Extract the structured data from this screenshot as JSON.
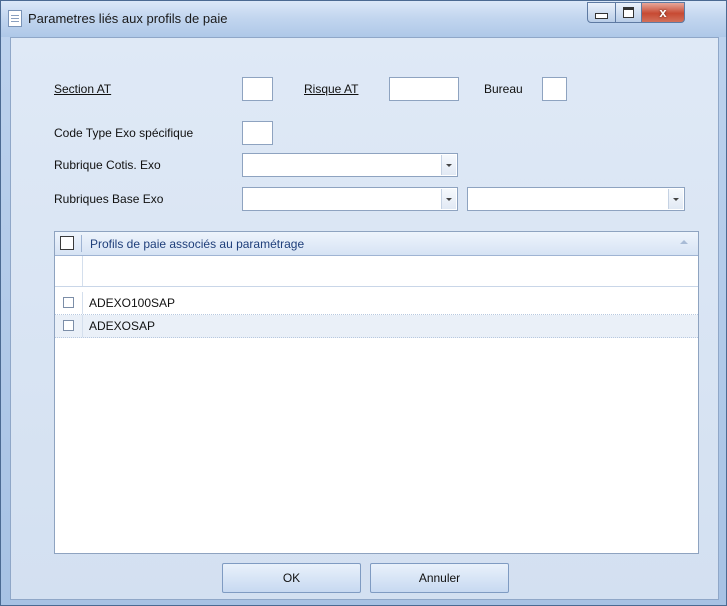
{
  "window": {
    "title": "Parametres liés aux profils de paie",
    "close_glyph": "x"
  },
  "form": {
    "section_at_label": "Section AT",
    "section_at_value": "",
    "risque_at_label": "Risque AT",
    "risque_at_value": "",
    "bureau_label": "Bureau",
    "bureau_value": "",
    "code_type_exo_label": "Code Type Exo spécifique",
    "code_type_exo_value": "",
    "rubrique_cotis_exo_label": "Rubrique Cotis. Exo",
    "rubrique_cotis_exo_value": "",
    "rubriques_base_exo_label": "Rubriques Base Exo",
    "rubriques_base_exo_value_1": "",
    "rubriques_base_exo_value_2": ""
  },
  "grid": {
    "column_header": "Profils de paie associés au paramétrage",
    "filter_value": "",
    "rows": [
      {
        "label": "ADEXO100SAP",
        "checked": false
      },
      {
        "label": "ADEXOSAP",
        "checked": false
      }
    ]
  },
  "buttons": {
    "ok_label": "OK",
    "cancel_label": "Annuler"
  },
  "icons": {
    "window": "document-icon",
    "minimize": "minimize-icon",
    "maximize": "maximize-icon",
    "close": "close-icon",
    "dropdown": "chevron-down-icon",
    "sort": "sort-up-icon"
  }
}
